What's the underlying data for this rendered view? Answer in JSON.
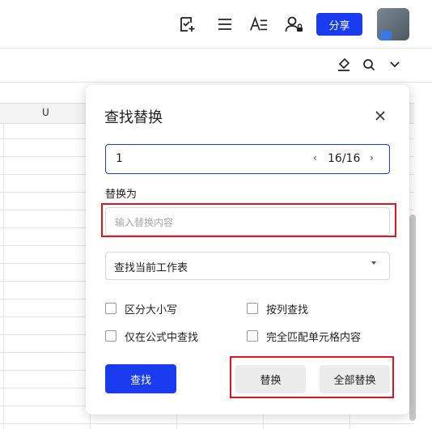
{
  "toolbar": {
    "share_label": "分享",
    "icons": [
      "checklist-add-icon",
      "menu-icon",
      "text-format-icon",
      "user-permission-icon",
      "highlight-icon",
      "search-icon",
      "chevron-down-icon"
    ]
  },
  "sheet": {
    "column_label": "U"
  },
  "dialog": {
    "title": "查找替换",
    "search": {
      "value": "1",
      "match_count": "16/16",
      "prev_glyph": "‹",
      "next_glyph": "›"
    },
    "replace": {
      "label": "替换为",
      "placeholder": "输入替换内容",
      "value": ""
    },
    "scope": {
      "selected": "查找当前工作表"
    },
    "options": [
      {
        "label": "区分大小写",
        "checked": false
      },
      {
        "label": "按列查找",
        "checked": false
      },
      {
        "label": "仅在公式中查找",
        "checked": false
      },
      {
        "label": "完全匹配单元格内容",
        "checked": false
      }
    ],
    "buttons": {
      "find": "查找",
      "replace": "替换",
      "replace_all": "全部替换"
    }
  },
  "colors": {
    "primary": "#1a3cf0",
    "highlight_box": "#e0161f"
  }
}
